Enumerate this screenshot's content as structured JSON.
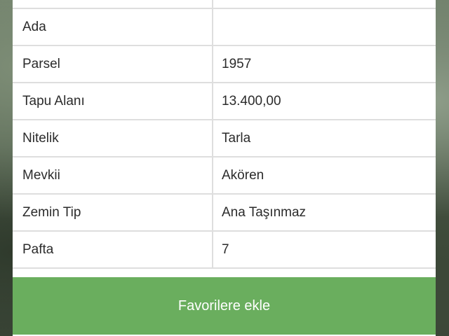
{
  "rows": [
    {
      "label": "",
      "value": ""
    },
    {
      "label": "Ada",
      "value": ""
    },
    {
      "label": "Parsel",
      "value": "1957"
    },
    {
      "label": "Tapu Alanı",
      "value": "13.400,00"
    },
    {
      "label": "Nitelik",
      "value": "Tarla"
    },
    {
      "label": "Mevkii",
      "value": "Akören"
    },
    {
      "label": "Zemin Tip",
      "value": "Ana Taşınmaz"
    },
    {
      "label": "Pafta",
      "value": "7"
    }
  ],
  "actions": {
    "favorite_label": "Favorilere ekle"
  },
  "colors": {
    "button_green": "#6aae5e",
    "row_border": "#dedede"
  }
}
